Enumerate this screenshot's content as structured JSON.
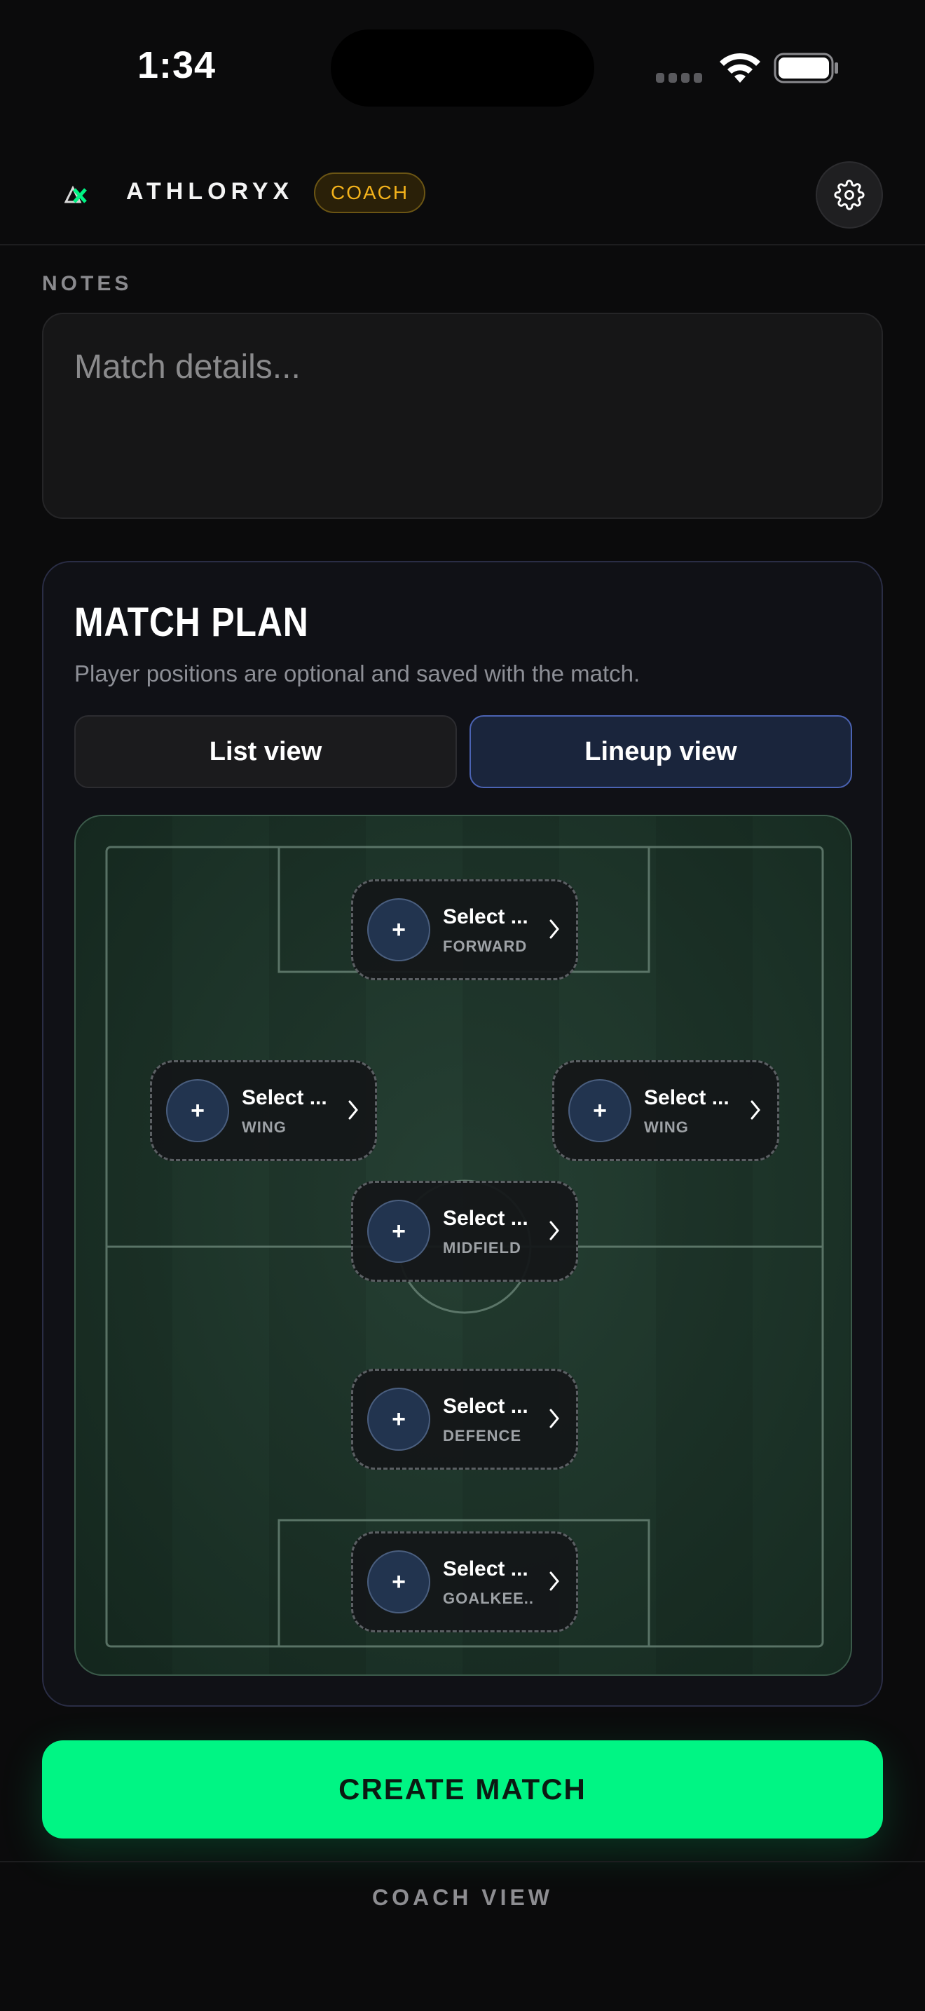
{
  "status_bar": {
    "time": "1:34"
  },
  "header": {
    "brand": "ATHLORYX",
    "badge": "COACH",
    "settings_icon": "gear-icon"
  },
  "notes": {
    "label": "NOTES",
    "placeholder": "Match details..."
  },
  "match_plan": {
    "title": "MATCH PLAN",
    "subtitle": "Player positions are optional and saved with the match.",
    "view_toggle": {
      "list_label": "List view",
      "lineup_label": "Lineup view",
      "selected": "Lineup view"
    },
    "slots": {
      "forward": {
        "name": "Select ...",
        "position": "FORWARD",
        "avatar": "+"
      },
      "left_wing": {
        "name": "Select ...",
        "position": "WING",
        "avatar": "+"
      },
      "right_wing": {
        "name": "Select ...",
        "position": "WING",
        "avatar": "+"
      },
      "midfield": {
        "name": "Select ...",
        "position": "MIDFIELD",
        "avatar": "+"
      },
      "defence": {
        "name": "Select ...",
        "position": "DEFENCE",
        "avatar": "+"
      },
      "goalkeeper": {
        "name": "Select ...",
        "position": "GOALKEE...",
        "avatar": "+"
      }
    }
  },
  "actions": {
    "create_label": "CREATE MATCH"
  },
  "footer": {
    "label": "COACH VIEW"
  },
  "colors": {
    "accent_green": "#00f584",
    "badge_gold": "#f3b21b",
    "selected_blue": "#4b63b3",
    "pitch_green": "#1a3327"
  }
}
